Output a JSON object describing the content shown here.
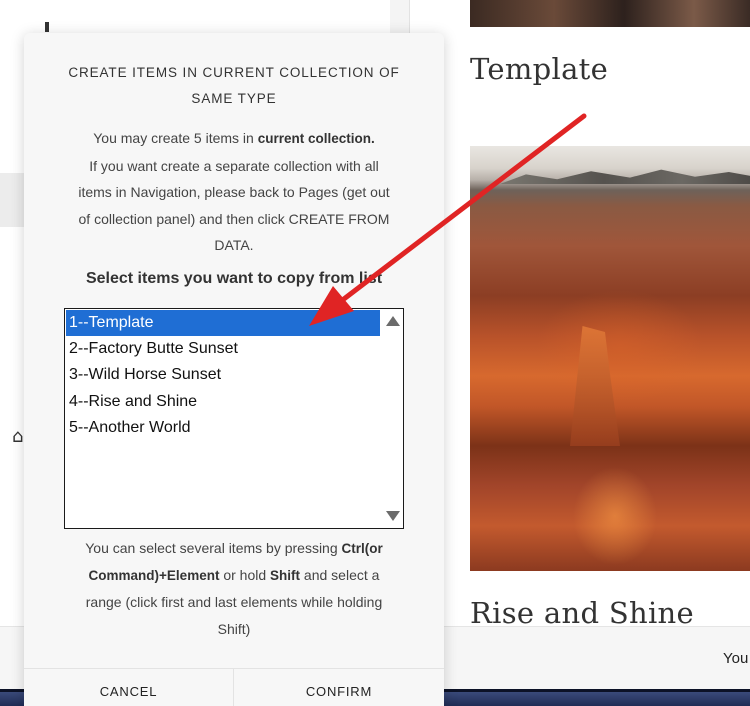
{
  "background": {
    "page_heading": "Template",
    "second_heading": "Rise and Shine",
    "bottom_bar_text": "You",
    "home_glyph": "⌂"
  },
  "modal": {
    "title_line1": "CREATE ITEMS IN CURRENT COLLECTION OF",
    "title_line2": "SAME TYPE",
    "desc": {
      "line1_prefix": "You may create 5 items in ",
      "line1_bold": "current collection.",
      "line2": "If you want create a separate collection with all",
      "line3": "items in Navigation, please back to Pages (get out",
      "line4": "of collection panel) and then click CREATE FROM",
      "line5": "DATA."
    },
    "subtitle": "Select items you want to copy from list",
    "list_items": [
      {
        "label": "1--Template",
        "selected": true
      },
      {
        "label": "2--Factory Butte Sunset",
        "selected": false
      },
      {
        "label": "3--Wild Horse Sunset",
        "selected": false
      },
      {
        "label": "4--Rise and Shine",
        "selected": false
      },
      {
        "label": "5--Another World",
        "selected": false
      }
    ],
    "hint": {
      "t1": "You can select several items by pressing ",
      "b1": "Ctrl(or",
      "b2": "Command)+Element",
      "t2": " or hold ",
      "b3": "Shift",
      "t3": " and select a",
      "t4": "range (click first and last elements while holding",
      "t5": "Shift)"
    },
    "cancel_label": "CANCEL",
    "confirm_label": "CONFIRM"
  },
  "colors": {
    "selection": "#1f6ed4",
    "annotation_arrow": "#e02424"
  },
  "icons": [
    "home-icon",
    "scroll-up-icon",
    "scroll-down-icon",
    "annotation-arrow"
  ]
}
